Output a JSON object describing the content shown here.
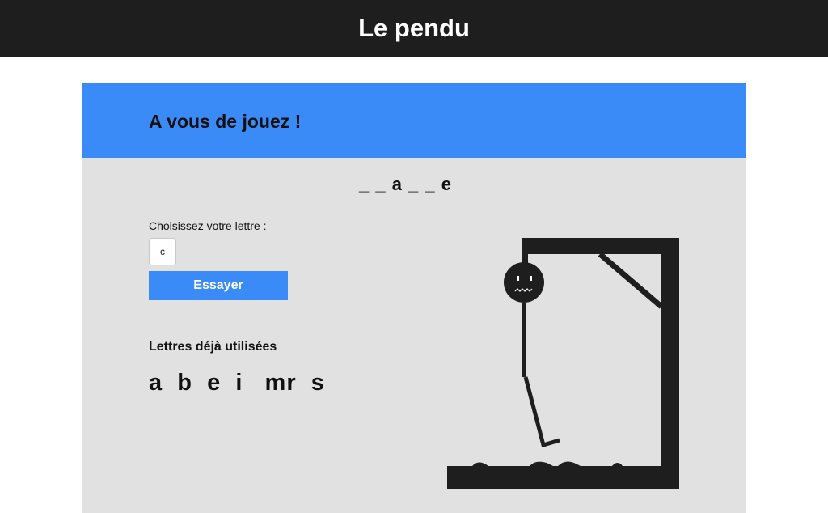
{
  "header": {
    "title": "Le pendu"
  },
  "game": {
    "heading": "A vous de jouez !",
    "word_display": "_ _ a _ _ e",
    "prompt_label": "Choisissez votre lettre :",
    "letter_input_value": "c",
    "try_button_label": "Essayer",
    "used_letters_title": "Lettres déjà utilisées",
    "used_letters": "a  b  e  i   mr  s"
  },
  "colors": {
    "header_bg": "#1e1e1e",
    "accent": "#3a8bf8",
    "panel_bg": "#e1e1e1",
    "drawing": "#1e1e1e"
  },
  "icons": {
    "hangman": "hangman-drawing-icon"
  }
}
